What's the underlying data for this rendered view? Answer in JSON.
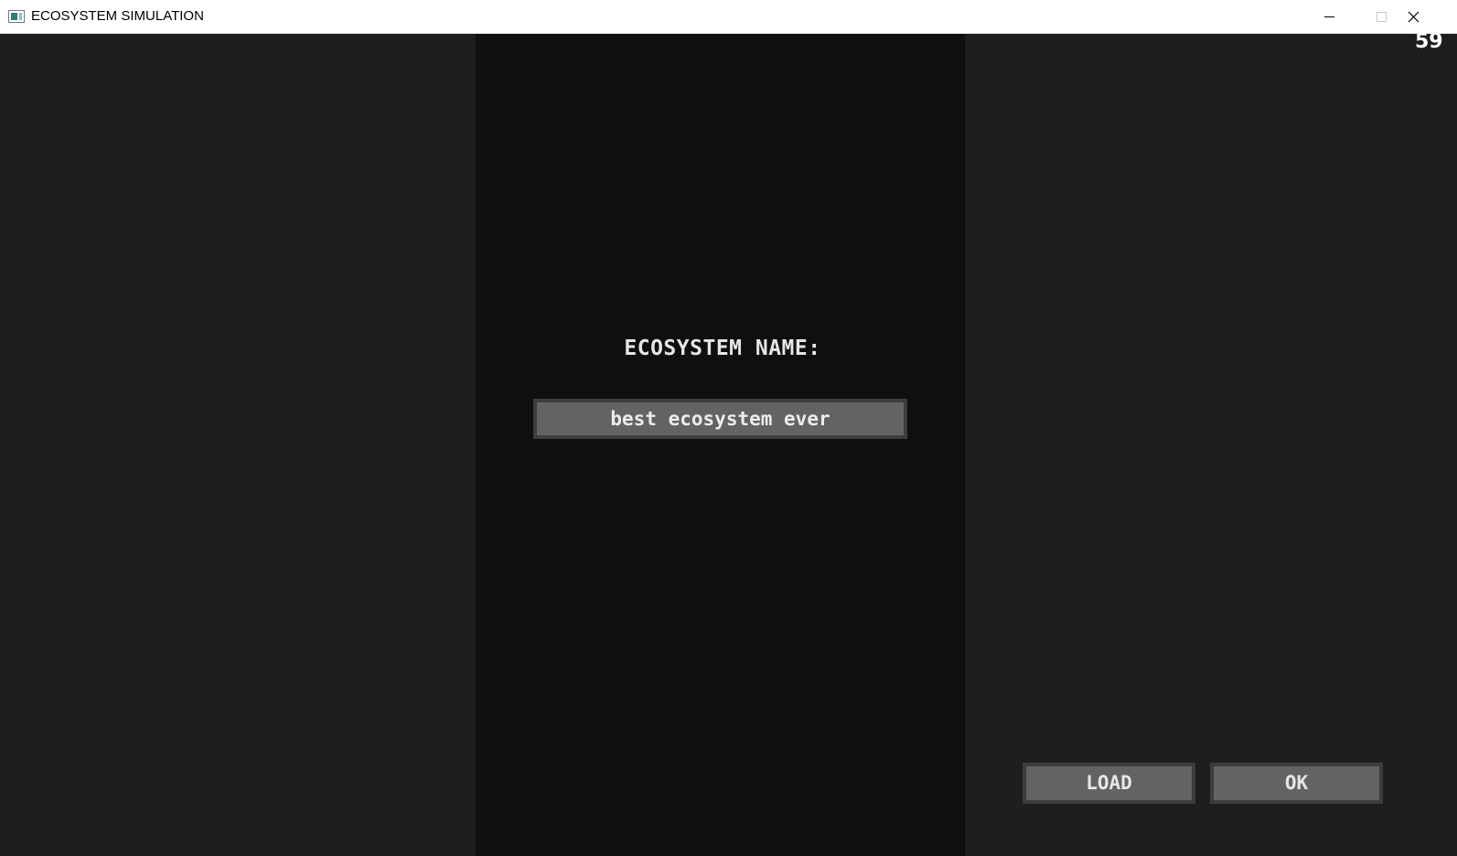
{
  "window": {
    "title": "ECOSYSTEM SIMULATION",
    "icon": "app-window-icon",
    "controls": {
      "minimize_icon": "minimize-icon",
      "maximize_icon": "maximize-icon",
      "close_icon": "close-icon"
    }
  },
  "overlay": {
    "fps_counter": "59"
  },
  "dialog": {
    "label": "ECOSYSTEM NAME:",
    "name_input_value": "best ecosystem ever"
  },
  "actions": {
    "load_label": "LOAD",
    "ok_label": "OK"
  },
  "colors": {
    "side_panel_bg": "#1e1e1e",
    "center_panel_bg": "#0f0f0f",
    "button_bg": "#636363",
    "button_border": "#3d3d3d",
    "text": "#e6e6e6"
  }
}
